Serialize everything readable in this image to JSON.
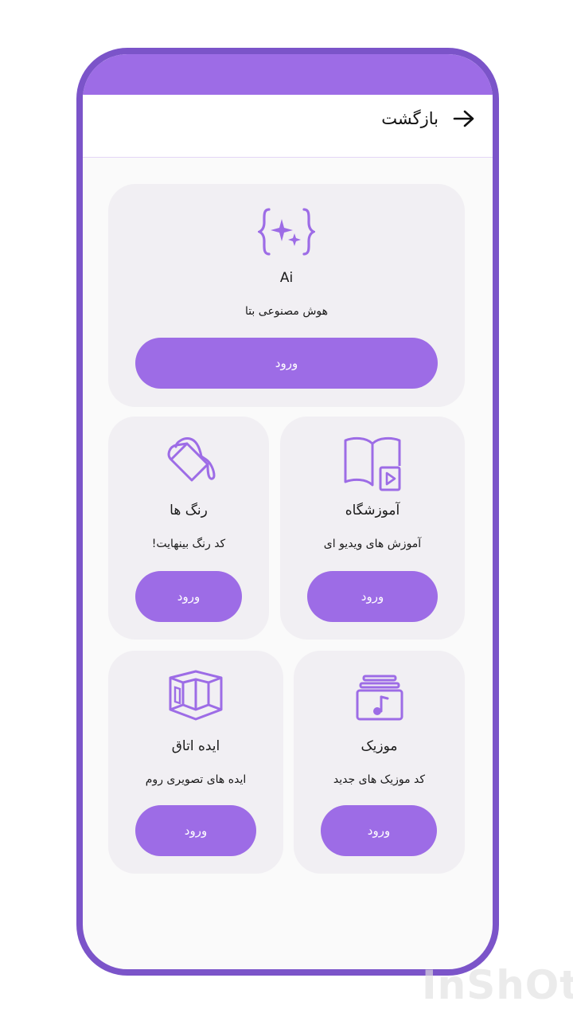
{
  "header": {
    "back_label": "بازگشت"
  },
  "cards": {
    "ai": {
      "title": "Ai",
      "description": "هوش مصنوعی بتا",
      "button": "ورود"
    },
    "colors": {
      "title": "رنگ ها",
      "description": "کد رنگ بینهایت!",
      "button": "ورود"
    },
    "academy": {
      "title": "آموزشگاه",
      "description": "آموزش های ویدیو ای",
      "button": "ورود"
    },
    "room": {
      "title": "ایده اتاق",
      "description": "ایده های تصویری روم",
      "button": "ورود"
    },
    "music": {
      "title": "موزیک",
      "description": "کد موزیک های جدید",
      "button": "ورود"
    }
  },
  "watermark": "InShOt",
  "colors": {
    "accent": "#9d6ce6",
    "frame": "#7b54c9",
    "card": "#f1eff3"
  }
}
